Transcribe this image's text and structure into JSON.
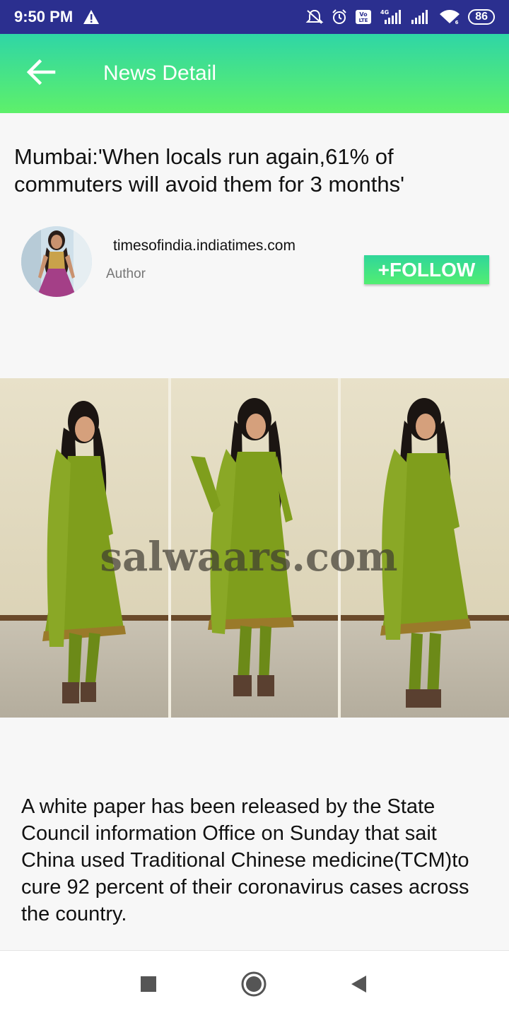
{
  "status_bar": {
    "time": "9:50 PM",
    "network": "4G",
    "volte": "Vo LTE",
    "battery": "86",
    "icons": [
      "warning-icon",
      "mute-icon",
      "alarm-icon",
      "volte-icon",
      "signal-icon",
      "signal-icon",
      "wifi-icon",
      "battery-icon"
    ]
  },
  "app_bar": {
    "title": "News Detail",
    "back_icon": "arrow-left-icon"
  },
  "article": {
    "headline": "Mumbai:'When locals run again,61% of commuters will avoid them for 3 months'",
    "source": "timesofindia.indiatimes.com",
    "author_label": "Author",
    "follow_label": "+FOLLOW",
    "image_watermark": "salwaars.com",
    "body": "A white paper has been released by the State Council information Office on Sunday that sait China used Traditional Chinese medicine(TCM)to cure 92 percent of their coronavirus cases across the country."
  },
  "nav_bar": {
    "icons": [
      "recents-square-icon",
      "home-circle-icon",
      "back-triangle-icon"
    ]
  },
  "colors": {
    "status_bar": "#2b2f8f",
    "app_bar_top": "#2fd6a6",
    "app_bar_bottom": "#5ef06a",
    "follow_button": "#3fe082",
    "dress_green": "#7f9e1c"
  }
}
